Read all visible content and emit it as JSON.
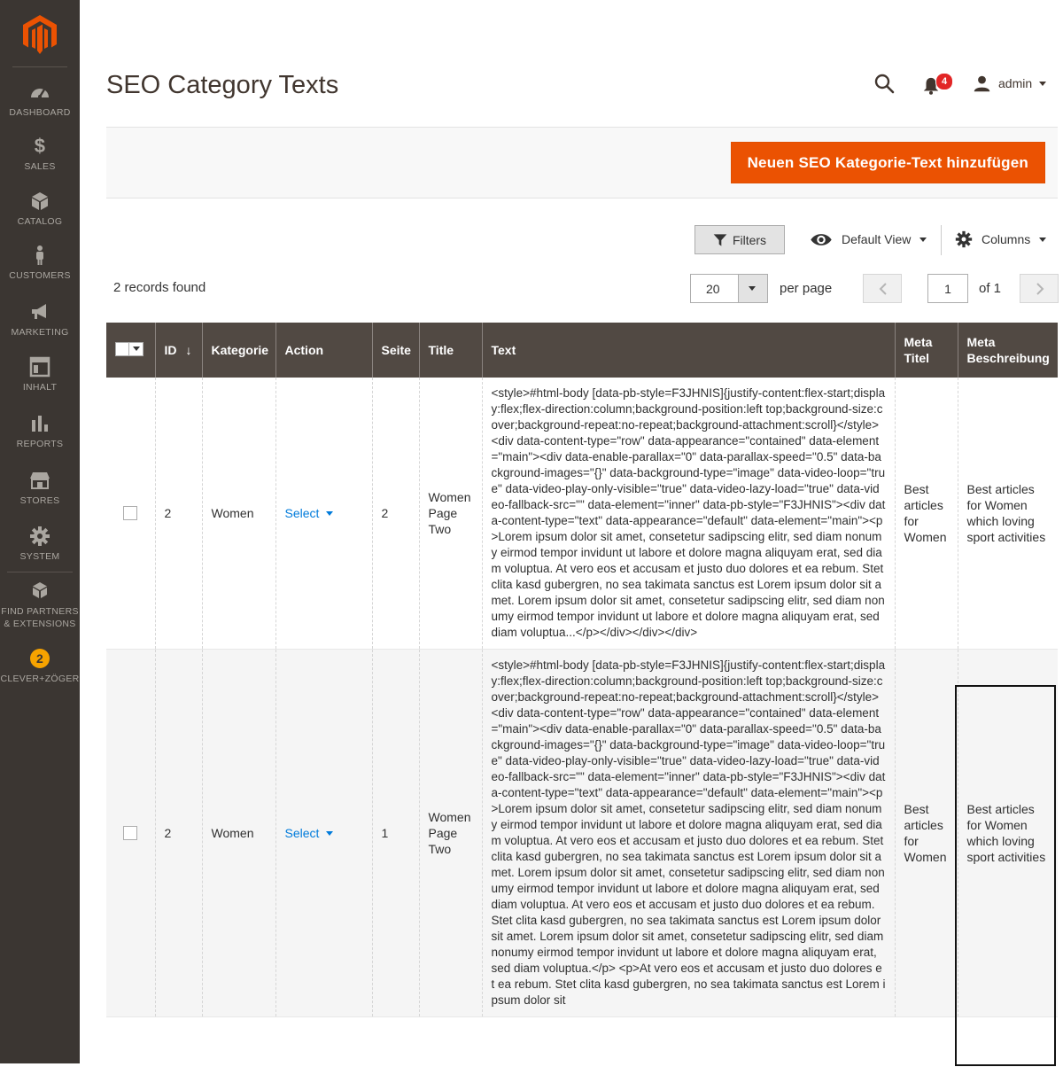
{
  "sidebar": {
    "items": [
      {
        "label": "DASHBOARD",
        "icon": "dashboard-icon"
      },
      {
        "label": "SALES",
        "icon": "dollar-icon"
      },
      {
        "label": "CATALOG",
        "icon": "box-icon"
      },
      {
        "label": "CUSTOMERS",
        "icon": "person-icon"
      },
      {
        "label": "MARKETING",
        "icon": "megaphone-icon"
      },
      {
        "label": "INHALT",
        "icon": "layout-icon"
      },
      {
        "label": "REPORTS",
        "icon": "bar-chart-icon"
      },
      {
        "label": "STORES",
        "icon": "store-icon"
      },
      {
        "label": "SYSTEM",
        "icon": "gear-icon"
      },
      {
        "label": "FIND PARTNERS",
        "label2": "& EXTENSIONS",
        "icon": "extensions-icon"
      },
      {
        "label": "CLEVER+ZÖGER",
        "icon": "clever-zoeger-icon"
      }
    ]
  },
  "header": {
    "title": "SEO Category Texts",
    "notifications_count": "4",
    "user_name": "admin"
  },
  "actions": {
    "add_label": "Neuen SEO Kategorie-Text hinzufügen"
  },
  "toolbar": {
    "filters_label": "Filters",
    "view_label": "Default View",
    "columns_label": "Columns",
    "records_found": "2 records found",
    "per_page_value": "20",
    "per_page_label": "per page",
    "current_page": "1",
    "page_total": "of 1"
  },
  "grid": {
    "columns": [
      "ID",
      "Kategorie",
      "Action",
      "Seite",
      "Title",
      "Text",
      "Meta Titel",
      "Meta Beschreibung"
    ],
    "rows": [
      {
        "id": "2",
        "category": "Women",
        "action": "Select",
        "page": "2",
        "title": "Women Page Two",
        "text": "<style>#html-body [data-pb-style=F3JHNIS]{justify-content:flex-start;display:flex;flex-direction:column;background-position:left top;background-size:cover;background-repeat:no-repeat;background-attachment:scroll}</style><div data-content-type=\"row\" data-appearance=\"contained\" data-element=\"main\"><div data-enable-parallax=\"0\" data-parallax-speed=\"0.5\" data-background-images=\"{}\" data-background-type=\"image\" data-video-loop=\"true\" data-video-play-only-visible=\"true\" data-video-lazy-load=\"true\" data-video-fallback-src=\"\" data-element=\"inner\" data-pb-style=\"F3JHNIS\"><div data-content-type=\"text\" data-appearance=\"default\" data-element=\"main\"><p>Lorem ipsum dolor sit amet, consetetur sadipscing elitr, sed diam nonumy eirmod tempor invidunt ut labore et dolore magna aliquyam erat, sed diam voluptua. At vero eos et accusam et justo duo dolores et ea rebum. Stet clita kasd gubergren, no sea takimata sanctus est Lorem ipsum dolor sit amet. Lorem ipsum dolor sit amet, consetetur sadipscing elitr, sed diam nonumy eirmod tempor invidunt ut labore et dolore magna aliquyam erat, sed diam voluptua...</p></div></div></div>",
        "meta_title": "Best articles for Women",
        "meta_description": "Best articles for Women which loving sport activities"
      },
      {
        "id": "2",
        "category": "Women",
        "action": "Select",
        "page": "1",
        "title": "Women Page Two",
        "text": "<style>#html-body [data-pb-style=F3JHNIS]{justify-content:flex-start;display:flex;flex-direction:column;background-position:left top;background-size:cover;background-repeat:no-repeat;background-attachment:scroll}</style><div data-content-type=\"row\" data-appearance=\"contained\" data-element=\"main\"><div data-enable-parallax=\"0\" data-parallax-speed=\"0.5\" data-background-images=\"{}\" data-background-type=\"image\" data-video-loop=\"true\" data-video-play-only-visible=\"true\" data-video-lazy-load=\"true\" data-video-fallback-src=\"\" data-element=\"inner\" data-pb-style=\"F3JHNIS\"><div data-content-type=\"text\" data-appearance=\"default\" data-element=\"main\"><p>Lorem ipsum dolor sit amet, consetetur sadipscing elitr, sed diam nonumy eirmod tempor invidunt ut labore et dolore magna aliquyam erat, sed diam voluptua. At vero eos et accusam et justo duo dolores et ea rebum. Stet clita kasd gubergren, no sea takimata sanctus est Lorem ipsum dolor sit amet. Lorem ipsum dolor sit amet, consetetur sadipscing elitr, sed diam nonumy eirmod tempor invidunt ut labore et dolore magna aliquyam erat, sed diam voluptua. At vero eos et accusam et justo duo dolores et ea rebum. Stet clita kasd gubergren, no sea takimata sanctus est Lorem ipsum dolor sit amet. Lorem ipsum dolor sit amet, consetetur sadipscing elitr, sed diam nonumy eirmod tempor invidunt ut labore et dolore magna aliquyam erat, sed diam voluptua.</p> <p>At vero eos et accusam et justo duo dolores et ea rebum. Stet clita kasd gubergren, no sea takimata sanctus est Lorem ipsum dolor sit",
        "meta_title": "Best articles for Women",
        "meta_description": "Best articles for Women which loving sport activities"
      }
    ]
  },
  "colors": {
    "sidebar_bg": "#3b3632",
    "brand_orange": "#eb5202",
    "grid_header_bg": "#514943",
    "link_blue": "#007bdb",
    "badge_red": "#e22626"
  }
}
